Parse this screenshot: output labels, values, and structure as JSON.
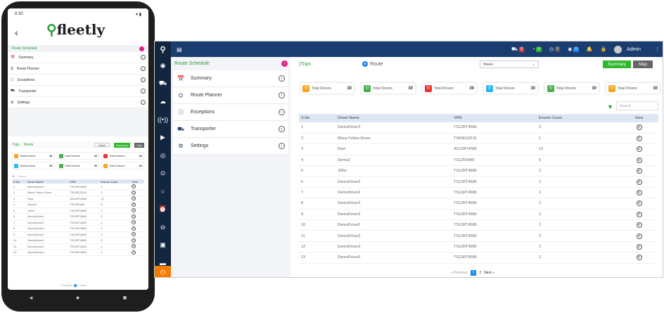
{
  "phone": {
    "time": "8:30",
    "status_icons": "▾ ▮",
    "logo": "fleetly",
    "route_schedule": "Route Schedule",
    "menu": [
      {
        "label": "Summary",
        "icon": "calendar-icon"
      },
      {
        "label": "Route Planner",
        "icon": "route-icon"
      },
      {
        "label": "Exceptions",
        "icon": "exclamation-icon"
      },
      {
        "label": "Transporter",
        "icon": "truck-icon"
      },
      {
        "label": "Settings",
        "icon": "gear-icon"
      }
    ],
    "trips": "Trips",
    "route": "Route",
    "week": "Week",
    "summary_btn": "Summary",
    "map_btn": "Map",
    "cards": [
      {
        "label": "Total Drivers",
        "value": "30",
        "color": "#f5a623"
      },
      {
        "label": "Total Drivers",
        "value": "30",
        "color": "#4caf50"
      },
      {
        "label": "Total Drivers",
        "value": "30",
        "color": "#e53935"
      },
      {
        "label": "Total Drivers",
        "value": "30",
        "color": "#29b6f6"
      },
      {
        "label": "Total Drivers",
        "value": "30",
        "color": "#4caf50"
      },
      {
        "label": "Total Drivers",
        "value": "30",
        "color": "#f5a623"
      }
    ],
    "search": "Search",
    "headers": [
      "S.No",
      "Driver Name",
      "VRN",
      "Events Count",
      "View"
    ],
    "rows": [
      [
        "1",
        "DemoDriver2",
        "TS12RT4589",
        "2"
      ],
      [
        "2",
        "Mane Fdduo Driver",
        "TS03EQ3131",
        "1"
      ],
      [
        "3",
        "Ravi",
        "AS12RT4589",
        "12"
      ],
      [
        "4",
        "Demo2",
        "TS12R3489",
        "5"
      ],
      [
        "5",
        "JOhn",
        "TS12RT4589",
        "2"
      ],
      [
        "6",
        "DemoDriver2",
        "TS12RT4589",
        "2"
      ],
      [
        "7",
        "DemoDriver2",
        "TS12RT4589",
        "2"
      ],
      [
        "8",
        "DemoDriver2",
        "TS12RT4589",
        "2"
      ],
      [
        "9",
        "DemoDriver2",
        "TS12RT4589",
        "2"
      ],
      [
        "10",
        "DemoDriver2",
        "TS12RT4589",
        "2"
      ],
      [
        "11",
        "DemoDriver2",
        "TS12RT4589",
        "2"
      ],
      [
        "12",
        "DemoDriver2",
        "TS12RT4589",
        "2"
      ]
    ],
    "pager": {
      "prev": "« Previous",
      "page1": "1",
      "page2": "2",
      "next": "Next »"
    }
  },
  "topbar": {
    "badges": [
      {
        "icon": "truck-icon",
        "value": "0",
        "color": "#e53935"
      },
      {
        "icon": "gauge-icon",
        "value": "0",
        "color": "#2eb82e"
      },
      {
        "icon": "clock-icon",
        "value": "0",
        "color": "#555555"
      },
      {
        "icon": "alert-icon",
        "value": "0",
        "color": "#1e88e5"
      }
    ],
    "admin": "Admin"
  },
  "route_schedule": {
    "title": "Route Schedule",
    "items": [
      {
        "label": "Summary",
        "icon": "calendar-icon"
      },
      {
        "label": "Route Planner",
        "icon": "route-icon"
      },
      {
        "label": "Exceptions",
        "icon": "exclamation-icon"
      },
      {
        "label": "Transporter",
        "icon": "truck-icon"
      },
      {
        "label": "Settings",
        "icon": "gear-icon"
      }
    ]
  },
  "main": {
    "trips": "Trips",
    "route": "Route",
    "week": "Week",
    "summary_btn": "Summary",
    "map_btn": "Map",
    "cards": [
      {
        "label": "Total Drivers",
        "value": "30",
        "color": "#f5a623"
      },
      {
        "label": "Total Drivers",
        "value": "30",
        "color": "#4caf50"
      },
      {
        "label": "Total Drivers",
        "value": "30",
        "color": "#e53935"
      },
      {
        "label": "Total Drivers",
        "value": "30",
        "color": "#29b6f6"
      },
      {
        "label": "Total Drivers",
        "value": "30",
        "color": "#4caf50"
      },
      {
        "label": "Total Drivers",
        "value": "30",
        "color": "#f5a623"
      }
    ],
    "search_placeholder": "Search",
    "headers": [
      "S.No",
      "Driver Name",
      "VRN",
      "Events Count",
      "View"
    ],
    "rows": [
      [
        "1",
        "DemoDriver2",
        "TS12RT4589",
        "2"
      ],
      [
        "2",
        "Mane Fdduo Driver",
        "TS03EQ3131",
        "1"
      ],
      [
        "3",
        "Ravi",
        "AS12RT4589",
        "12"
      ],
      [
        "4",
        "Demo2",
        "TS12R3489",
        "5"
      ],
      [
        "5",
        "JOhn",
        "TS12RT4589",
        "2"
      ],
      [
        "6",
        "DemoDriver2",
        "TS12RT4589",
        "2"
      ],
      [
        "7",
        "DemoDriver2",
        "TS12RT4589",
        "2"
      ],
      [
        "8",
        "DemoDriver2",
        "TS12RT4589",
        "2"
      ],
      [
        "9",
        "DemoDriver2",
        "TS12RT4589",
        "2"
      ],
      [
        "10",
        "DemoDriver2",
        "TS12RT4589",
        "2"
      ],
      [
        "11",
        "DemoDriver2",
        "TS12RT4589",
        "2"
      ],
      [
        "12",
        "DemoDriver2",
        "TS12RT4589",
        "2"
      ],
      [
        "13",
        "DemoDriver2",
        "TS12RT4589",
        "2"
      ]
    ],
    "pager": {
      "prev": "« Previous",
      "page1": "1",
      "page2": "2",
      "next": "Next »"
    }
  }
}
